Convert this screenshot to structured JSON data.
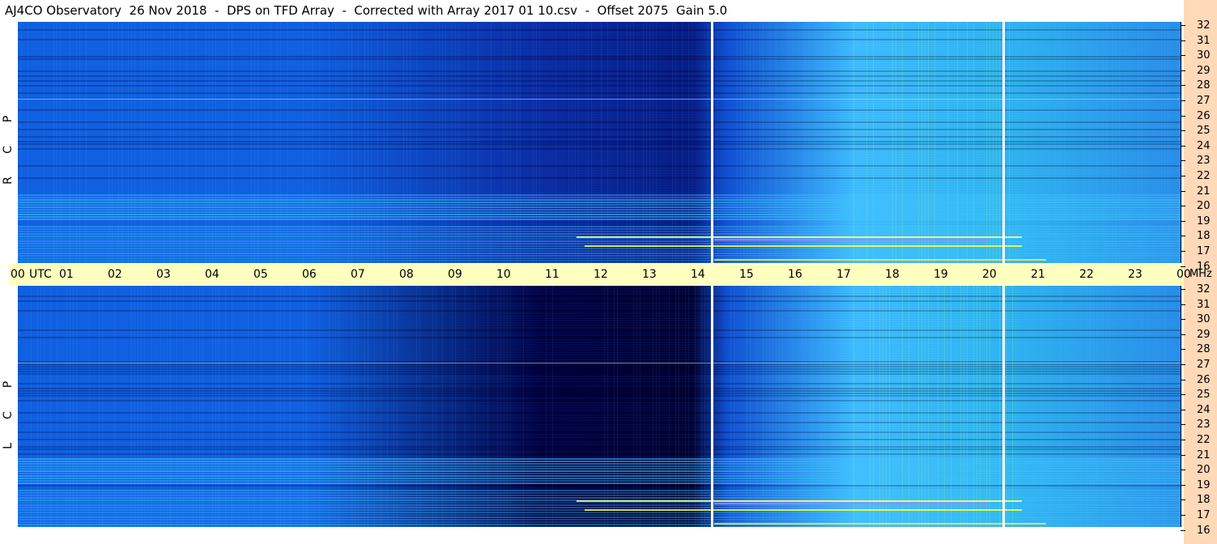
{
  "title": "AJ4CO Observatory  26 Nov 2018  -  DPS on TFD Array  -  Corrected with Array 2017 01 10.csv  -  Offset 2075  Gain 5.0",
  "panels": [
    {
      "id": "rcp",
      "letters": [
        "R",
        "C",
        "P"
      ]
    },
    {
      "id": "lcp",
      "letters": [
        "L",
        "C",
        "P"
      ]
    }
  ],
  "time_axis": {
    "labels": [
      "00",
      "01",
      "02",
      "03",
      "04",
      "05",
      "06",
      "07",
      "08",
      "09",
      "10",
      "11",
      "12",
      "13",
      "14",
      "15",
      "16",
      "17",
      "18",
      "19",
      "20",
      "21",
      "22",
      "23",
      "00"
    ],
    "utc_label": "UTC",
    "mhz_label": "MHz"
  },
  "frequency_axis": {
    "labels": [
      "32",
      "31",
      "30",
      "29",
      "28",
      "27",
      "26",
      "25",
      "24",
      "23",
      "22",
      "21",
      "20",
      "19",
      "18",
      "17",
      "16"
    ]
  },
  "colors": {
    "background": "#ffffff",
    "time_axis_bg": "#ffffc0",
    "side_strip": "#ffd9b8",
    "spectrogram_dark": "#000060",
    "spectrogram_mid": "#1060e0",
    "spectrogram_light": "#40c0ff",
    "spectrogram_hot": "#ffff40"
  }
}
